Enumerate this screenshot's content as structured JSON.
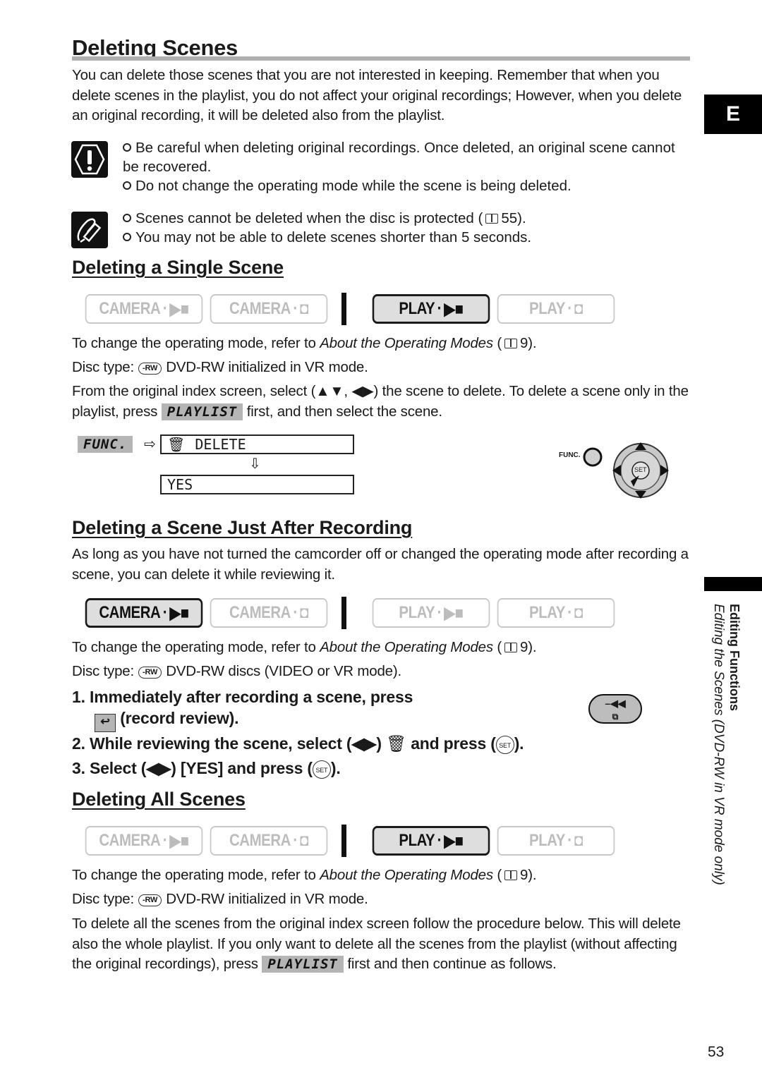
{
  "page": {
    "title": "Deleting Scenes",
    "intro": "You can delete those scenes that you are not interested in keeping. Remember that when you delete scenes in the playlist, you do not affect your original recordings; However, when you delete an original recording, it will be deleted also from the playlist.",
    "language_tab": "E",
    "page_number": "53"
  },
  "cautions": [
    "Be careful when deleting original recordings. Once deleted, an original scene cannot be recovered.",
    "Do not change the operating mode while the scene is being deleted."
  ],
  "notes": {
    "note1_pre": "Scenes cannot be deleted when the disc is protected (",
    "note1_ref": "55",
    "note1_post": ").",
    "note2": "You may not be able to delete scenes shorter than 5 seconds."
  },
  "modes": {
    "camera": "CAMERA",
    "play": "PLAY",
    "dot": "·"
  },
  "common": {
    "operating_pre": "To change the operating mode, refer to ",
    "operating_link": "About the Operating Modes",
    "operating_mid": " (",
    "operating_ref": "9",
    "operating_post": ").",
    "disc_label": "Disc type:",
    "rw_icon": "-RW",
    "playlist_key": "PLAYLIST"
  },
  "single": {
    "heading": "Deleting a Single Scene",
    "active_mode": "PLAY · movie",
    "disc_type": "DVD-RW initialized in VR mode.",
    "body_pre": "From the original index screen, select (",
    "arrows_ud": "▲▼",
    "arrows_sep": ", ",
    "arrows_lr": "◀▶",
    "body_mid": ") the scene to delete. To delete a scene only in the playlist, press ",
    "body_post": " first, and then select the scene.",
    "func_label": "FUNC.",
    "menu_delete": "DELETE",
    "menu_yes": "YES",
    "diagram_func": "FUNC.",
    "diagram_set": "SET"
  },
  "after_rec": {
    "heading": "Deleting a Scene Just After Recording",
    "body": "As long as you have not turned the camcorder off or changed the operating mode after recording a scene, you can delete it while reviewing it.",
    "active_mode": "CAMERA · movie",
    "disc_type": "DVD-RW discs (VIDEO or VR mode).",
    "step1_num": "1.",
    "step1_a": "Immediately after recording a scene, press",
    "step1_b": "(record review).",
    "step2_num": "2.",
    "step2_a": "While reviewing the scene, select (",
    "step2_b": ") ",
    "step2_c": " and press (",
    "step2_d": ").",
    "step3_num": "3.",
    "step3_a": "Select (",
    "step3_b": ") [YES] and press (",
    "step3_c": ").",
    "set_label": "SET",
    "button_label": "–◀◀"
  },
  "all": {
    "heading": "Deleting All Scenes",
    "active_mode": "PLAY · movie",
    "disc_type": "DVD-RW initialized in VR mode.",
    "body_pre": "To delete all the scenes from the original index screen follow the procedure below. This will delete also the whole playlist. If you only want to delete all the scenes from the playlist (without affecting the original recordings), press ",
    "body_post": " first and then continue as follows."
  },
  "sidebar": {
    "section": "Editing Functions",
    "subsection": "Editing the Scenes (DVD-RW in VR mode only)"
  }
}
